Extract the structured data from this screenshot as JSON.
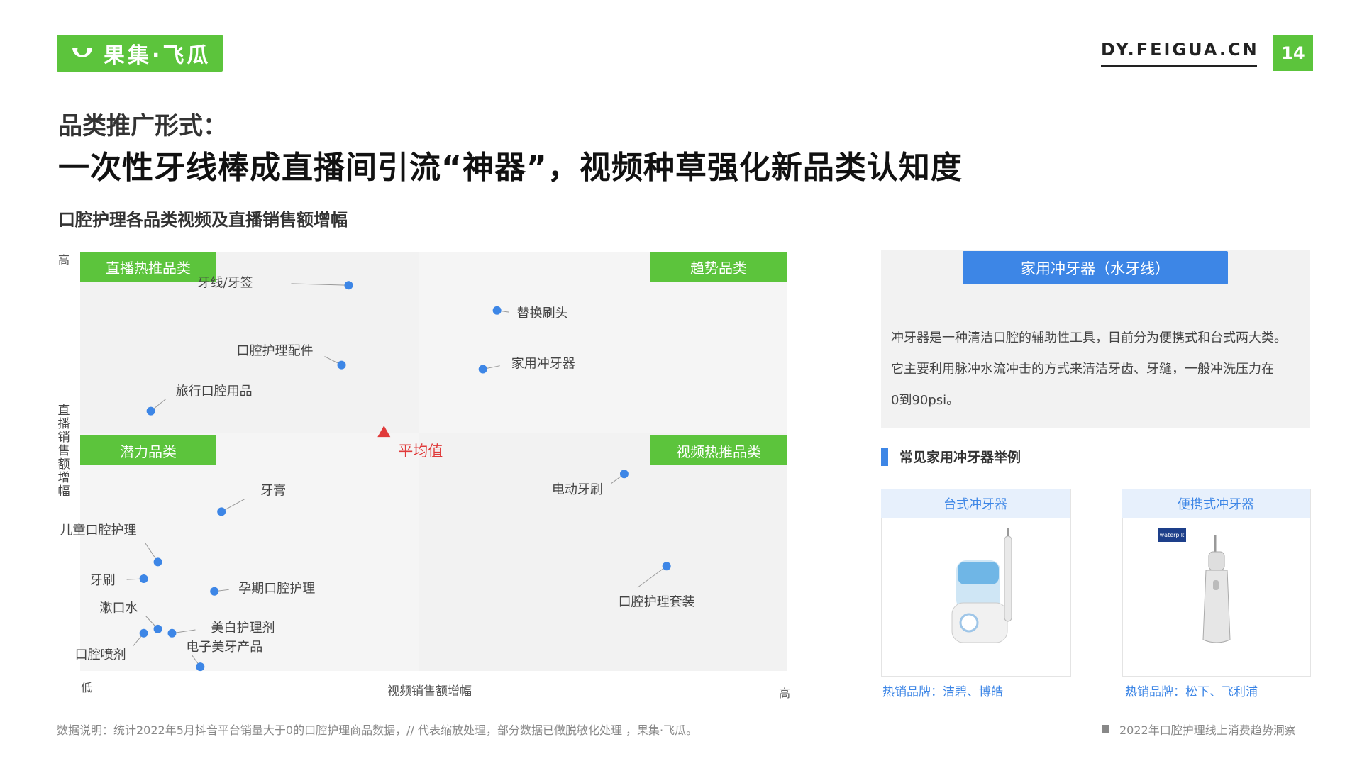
{
  "header": {
    "logo_text": "果集·飞瓜",
    "site": "DY.FEIGUA.CN",
    "page_number": "14"
  },
  "title": {
    "line1": "品类推广形式：",
    "line2": "一次性牙线棒成直播间引流“神器”，视频种草强化新品类认知度"
  },
  "chart_data": {
    "type": "scatter",
    "title": "口腔护理各品类视频及直播销售额增幅",
    "xlabel": "视频销售额增幅",
    "ylabel": "直播销售额增幅",
    "x_low_label": "低",
    "x_high_label": "高",
    "y_high_label": "高",
    "average_label": "平均值",
    "quadrants": [
      "直播热推品类",
      "趋势品类",
      "潜力品类",
      "视频热推品类"
    ],
    "average": {
      "x": 0.43,
      "y": 0.57
    },
    "points": [
      {
        "name": "牙线/牙签",
        "x": 0.38,
        "y": 0.92
      },
      {
        "name": "替换刷头",
        "x": 0.59,
        "y": 0.86
      },
      {
        "name": "口腔护理配件",
        "x": 0.37,
        "y": 0.73
      },
      {
        "name": "家用冲牙器",
        "x": 0.57,
        "y": 0.72
      },
      {
        "name": "旅行口腔用品",
        "x": 0.1,
        "y": 0.62
      },
      {
        "name": "电动牙刷",
        "x": 0.77,
        "y": 0.47
      },
      {
        "name": "牙膏",
        "x": 0.2,
        "y": 0.38
      },
      {
        "name": "儿童口腔护理",
        "x": 0.11,
        "y": 0.26
      },
      {
        "name": "口腔护理套装",
        "x": 0.83,
        "y": 0.25
      },
      {
        "name": "牙刷",
        "x": 0.09,
        "y": 0.22
      },
      {
        "name": "孕期口腔护理",
        "x": 0.19,
        "y": 0.19
      },
      {
        "name": "漱口水",
        "x": 0.11,
        "y": 0.1
      },
      {
        "name": "美白护理剂",
        "x": 0.13,
        "y": 0.09
      },
      {
        "name": "口腔喷剂",
        "x": 0.09,
        "y": 0.09
      },
      {
        "name": "电子美牙产品",
        "x": 0.17,
        "y": 0.01
      }
    ],
    "dot_color": "#3d86e6",
    "average_color": "#e03a3a",
    "quadrant_tag_color": "#5cc43c"
  },
  "panel": {
    "button": "家用冲牙器（水牙线）",
    "lines": [
      "冲牙器是一种清洁口腔的辅助性工具，目前分为便携式和台式两大类。",
      "它主要利用脉冲水流冲击的方式来清洁牙齿、牙缝，一般冲洗压力在",
      "0到90psi。"
    ]
  },
  "examples": {
    "title": "常见家用冲牙器举例",
    "cards": [
      {
        "name": "台式冲牙器",
        "brands": "热销品牌：洁碧、博皓"
      },
      {
        "name": "便携式冲牙器",
        "brands": "热销品牌：松下、飞利浦",
        "product_mark": "waterpik"
      }
    ]
  },
  "footer": {
    "note": "数据说明：统计2022年5月抖音平台销量大于0的口腔护理商品数据，// 代表缩放处理，部分数据已做脱敏化处理 ，果集·飞瓜。",
    "report": "2022年口腔护理线上消费趋势洞察"
  }
}
